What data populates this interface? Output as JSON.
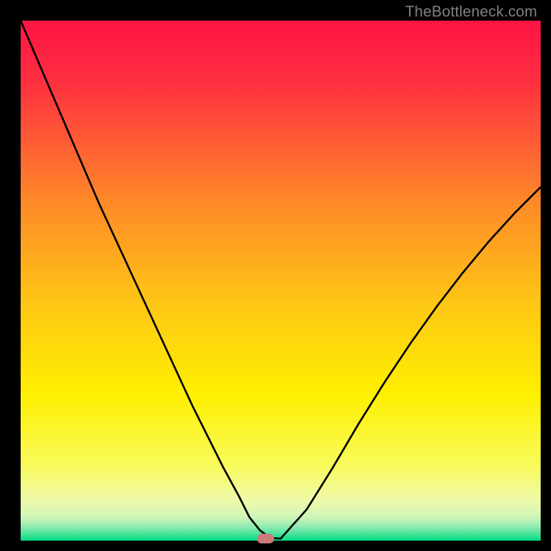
{
  "watermark": "TheBottleneck.com",
  "chart_data": {
    "type": "line",
    "title": "",
    "xlabel": "",
    "ylabel": "",
    "xlim": [
      0,
      100
    ],
    "ylim": [
      0,
      100
    ],
    "grid": false,
    "background_gradient": {
      "top": "#fe1444",
      "mid_upper": "#fe9026",
      "mid": "#fef000",
      "mid_lower": "#f6fb7c",
      "bottom": "#00dc82"
    },
    "series": [
      {
        "name": "bottleneck-curve",
        "color": "#000000",
        "x": [
          0,
          3,
          6,
          9,
          12,
          15,
          18,
          21,
          24,
          27,
          30,
          33,
          36,
          39,
          42,
          44,
          46,
          48,
          50,
          55,
          60,
          65,
          70,
          75,
          80,
          85,
          90,
          95,
          100
        ],
        "y": [
          100,
          93,
          86,
          79,
          72,
          65,
          58.5,
          52,
          45.5,
          39,
          32.5,
          26,
          20,
          14,
          8.5,
          4.5,
          2,
          0.5,
          0.4,
          6,
          14,
          22.5,
          30.5,
          38,
          45,
          51.5,
          57.5,
          63,
          68
        ]
      }
    ],
    "marker": {
      "name": "optimal-point",
      "x": 47,
      "y": 0,
      "color": "#cb7a78"
    }
  }
}
